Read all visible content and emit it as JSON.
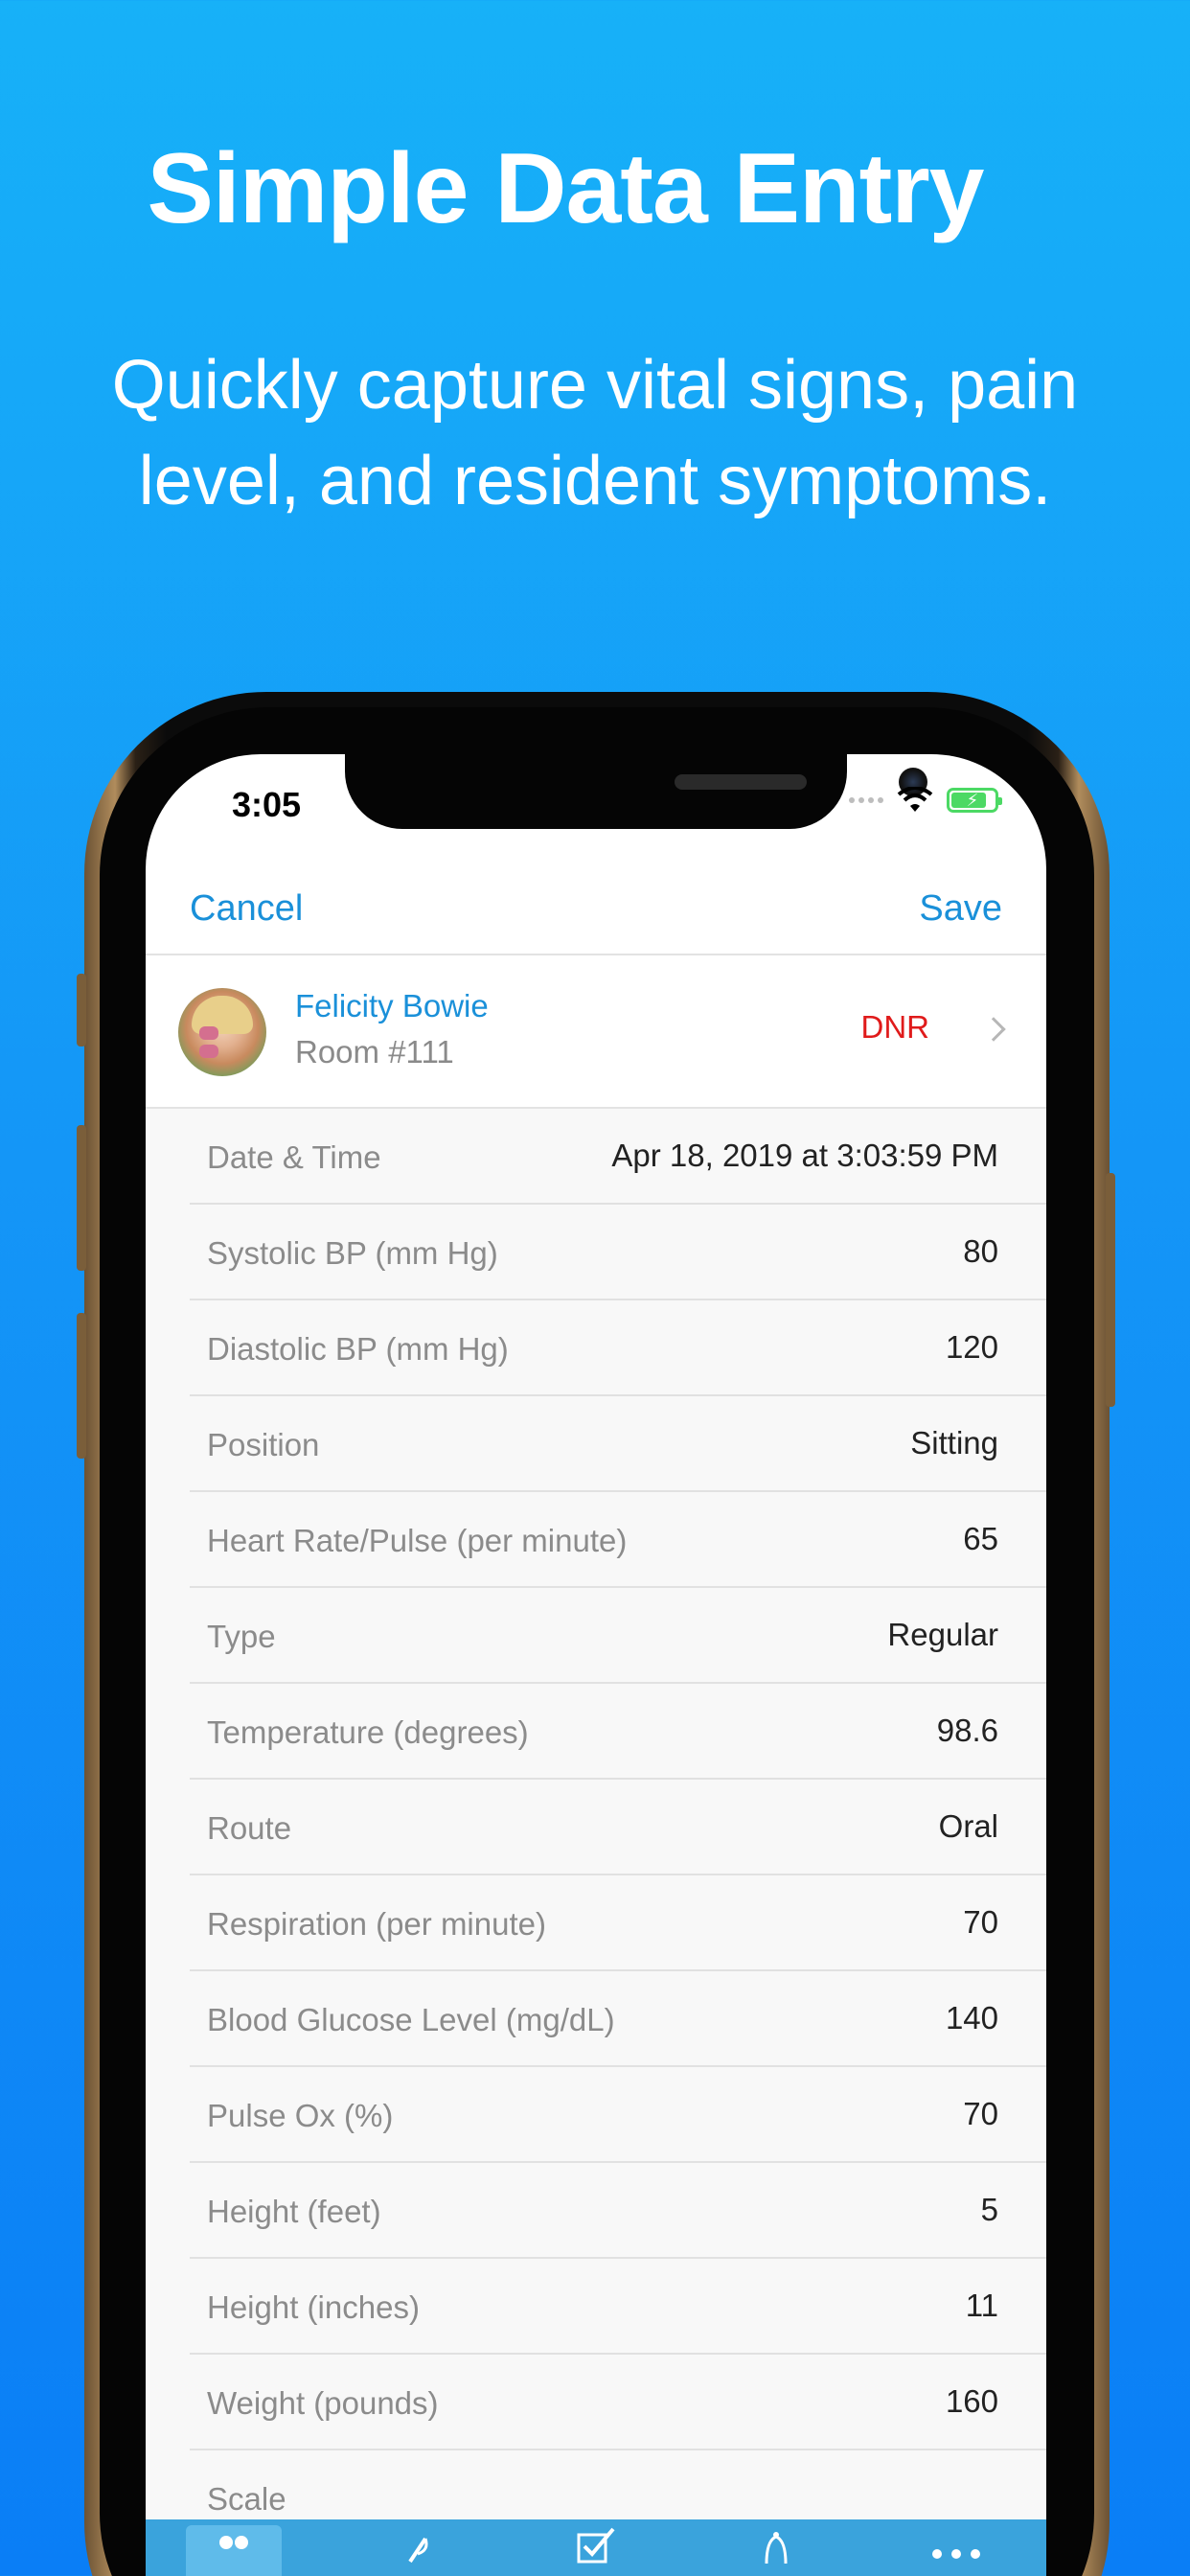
{
  "promo": {
    "headline": "Simple Data Entry",
    "subhead_line1": "Quickly capture vital signs, pain",
    "subhead_line2": "level, and resident symptoms."
  },
  "status_bar": {
    "time": "3:05"
  },
  "nav": {
    "cancel_label": "Cancel",
    "save_label": "Save"
  },
  "resident": {
    "name": "Felicity Bowie",
    "room": "Room #111",
    "code_status": "DNR"
  },
  "vitals": [
    {
      "label": "Date & Time",
      "value": "Apr 18, 2019 at 3:03:59 PM"
    },
    {
      "label": "Systolic BP (mm Hg)",
      "value": "80"
    },
    {
      "label": "Diastolic BP (mm Hg)",
      "value": "120"
    },
    {
      "label": "Position",
      "value": "Sitting"
    },
    {
      "label": "Heart Rate/Pulse (per minute)",
      "value": "65"
    },
    {
      "label": "Type",
      "value": "Regular"
    },
    {
      "label": "Temperature (degrees)",
      "value": "98.6"
    },
    {
      "label": "Route",
      "value": "Oral"
    },
    {
      "label": "Respiration (per minute)",
      "value": "70"
    },
    {
      "label": "Blood Glucose Level (mg/dL)",
      "value": "140"
    },
    {
      "label": "Pulse Ox (%)",
      "value": "70"
    },
    {
      "label": "Height (feet)",
      "value": "5"
    },
    {
      "label": "Height (inches)",
      "value": "11"
    },
    {
      "label": "Weight (pounds)",
      "value": "160"
    },
    {
      "label": "Scale",
      "value": ""
    }
  ],
  "tabbar": {
    "items": [
      {
        "icon": "residents-icon"
      },
      {
        "icon": "pill-icon"
      },
      {
        "icon": "checklist-icon"
      },
      {
        "icon": "bell-icon"
      },
      {
        "icon": "more-icon"
      }
    ]
  },
  "colors": {
    "accent": "#1a90d9",
    "dnr": "#e01b1b",
    "background_top": "#17b1f8",
    "background_bottom": "#0a7ef6",
    "tabbar": "#3aa3dc"
  }
}
